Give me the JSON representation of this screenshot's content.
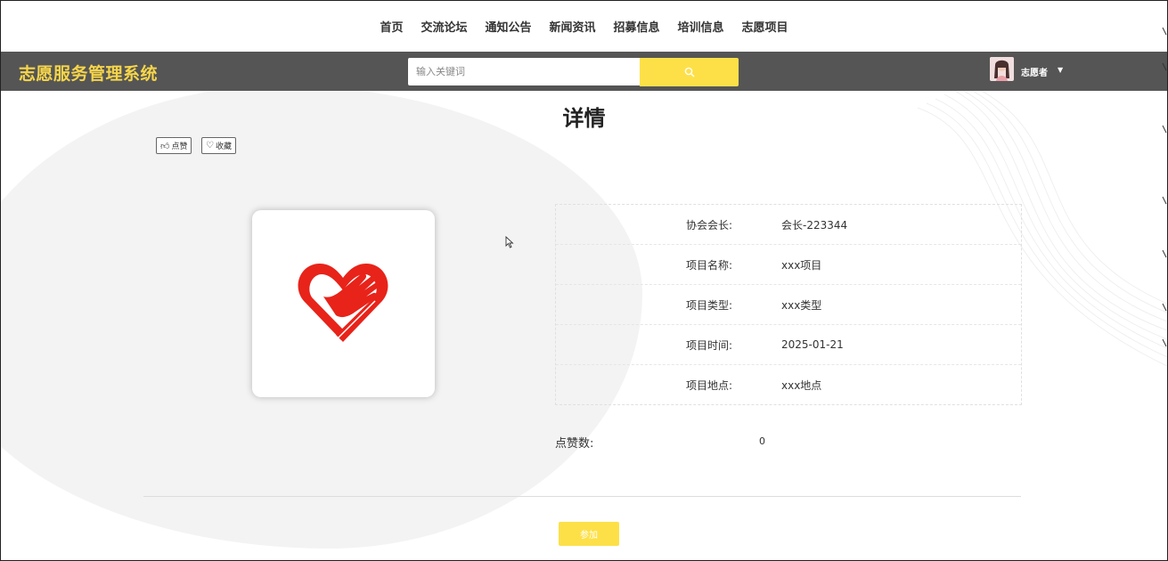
{
  "nav": {
    "items": [
      "首页",
      "交流论坛",
      "通知公告",
      "新闻资讯",
      "招募信息",
      "培训信息",
      "志愿项目"
    ]
  },
  "header": {
    "brand": "志愿服务管理系统",
    "search_placeholder": "输入关键词",
    "search_icon": "search-icon",
    "user_name": "志愿者",
    "user_caret_icon": "caret-down-icon"
  },
  "page": {
    "title": "详情",
    "like_button": "点赞",
    "like_icon": "thumb-up-icon",
    "favorite_button": "收藏",
    "favorite_icon": "heart-outline-icon",
    "image_icon": "volunteer-heart-hand-logo"
  },
  "details": [
    {
      "label": "协会会长:",
      "value": "会长-223344"
    },
    {
      "label": "项目名称:",
      "value": "xxx项目"
    },
    {
      "label": "项目类型:",
      "value": "xxx类型"
    },
    {
      "label": "项目时间:",
      "value": "2025-01-21"
    },
    {
      "label": "项目地点:",
      "value": "xxx地点"
    }
  ],
  "likes": {
    "label": "点赞数:",
    "value": "0"
  },
  "join_button": "参加",
  "colors": {
    "accent": "#fde048",
    "brand_text": "#f6d54a",
    "header_bg": "#555555",
    "logo_red": "#e8231a"
  }
}
